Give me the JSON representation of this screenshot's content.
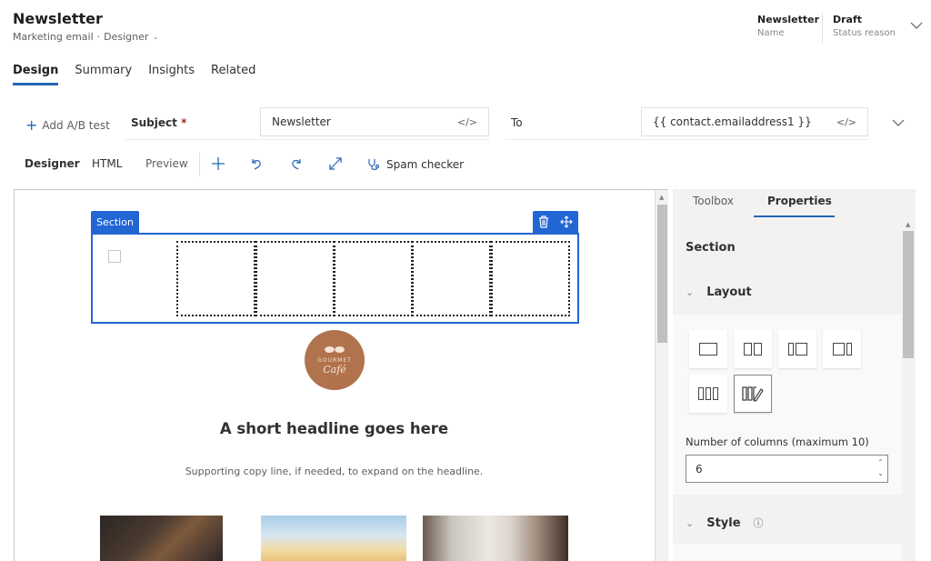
{
  "header": {
    "title": "Newsletter",
    "entity": "Marketing email",
    "separator": "·",
    "form": "Designer",
    "fields": [
      {
        "value": "Newsletter",
        "label": "Name"
      },
      {
        "value": "Draft",
        "label": "Status reason"
      }
    ]
  },
  "tabs": [
    {
      "label": "Design",
      "active": true
    },
    {
      "label": "Summary",
      "active": false
    },
    {
      "label": "Insights",
      "active": false
    },
    {
      "label": "Related",
      "active": false
    }
  ],
  "email_fields": {
    "add_ab_label": "Add A/B test",
    "subject_label": "Subject",
    "required_mark": "*",
    "subject_value": "Newsletter",
    "to_label": "To",
    "to_value": "{{ contact.emailaddress1 }}",
    "code_icon": "</>"
  },
  "toolbar": {
    "designer": "Designer",
    "html": "HTML",
    "preview": "Preview",
    "icons": [
      "add-icon",
      "undo-icon",
      "redo-icon",
      "expand-icon"
    ],
    "spam_checker": "Spam checker"
  },
  "canvas": {
    "section_label": "Section",
    "visible_columns": 5,
    "logo": {
      "brand": "GOURMET",
      "name": "Café"
    },
    "headline": "A short headline goes here",
    "copy": "Supporting copy line, if needed, to expand on the headline."
  },
  "panel": {
    "tabs": [
      {
        "label": "Toolbox",
        "active": false
      },
      {
        "label": "Properties",
        "active": true
      }
    ],
    "section_title": "Section",
    "layout_label": "Layout",
    "layout_options": [
      "one-column",
      "two-columns",
      "narrow-wide",
      "wide-narrow",
      "three-columns",
      "custom"
    ],
    "selected_layout": "custom",
    "columns_label": "Number of columns (maximum 10)",
    "columns_value": "6",
    "style_label": "Style"
  },
  "colors": {
    "accent": "#2266b5",
    "section_blue": "#2266d4",
    "logo_brown": "#b0734d"
  }
}
